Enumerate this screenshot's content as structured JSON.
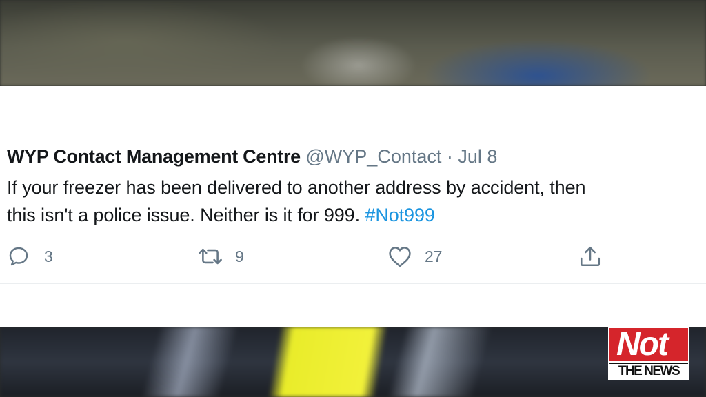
{
  "tweet": {
    "author_name": "WYP Contact Management Centre",
    "author_handle": "@WYP_Contact",
    "separator": "·",
    "date": "Jul 8",
    "text_line_1": "If your freezer has been delivered to another address by accident, then",
    "text_line_2_plain": "this isn't a police issue. Neither is it for 999.",
    "hashtag": "#Not999",
    "hashtag_color": "#1b95e0"
  },
  "actions": {
    "reply": {
      "icon": "reply-icon",
      "count": "3"
    },
    "retweet": {
      "icon": "retweet-icon",
      "count": "9"
    },
    "like": {
      "icon": "heart-icon",
      "count": "27"
    },
    "share": {
      "icon": "share-icon"
    }
  },
  "watermark": {
    "brand_top": "Not",
    "brand_bottom": "THE NEWS",
    "brand_color": "#d5252b"
  }
}
